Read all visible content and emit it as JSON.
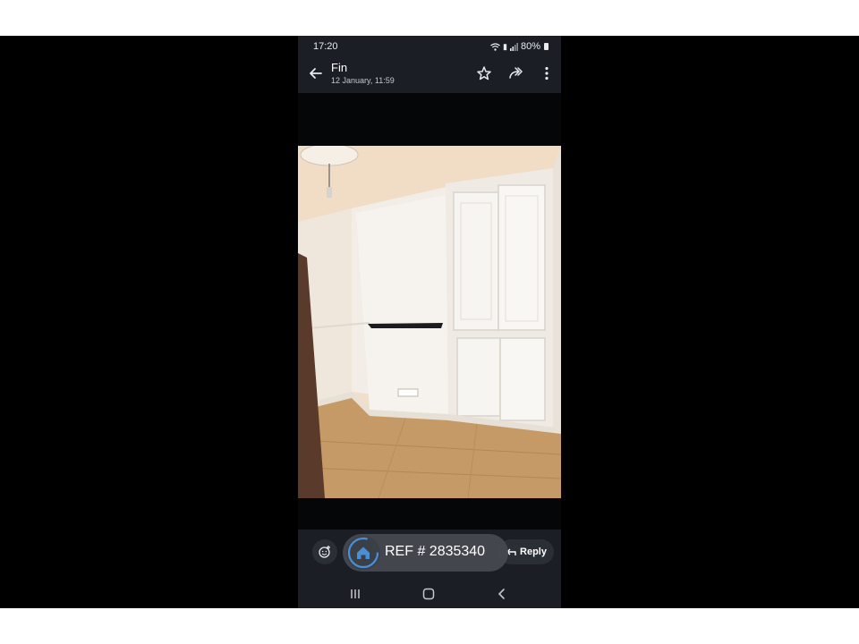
{
  "status_bar": {
    "time": "17:20",
    "battery": "80%",
    "icons": [
      "wifi-icon",
      "volte-icon",
      "signal-icon",
      "battery-icon"
    ]
  },
  "app_bar": {
    "sender": "Fin",
    "date": "12 January, 11:59",
    "actions": [
      "star-icon",
      "forward-icon",
      "more-vert-icon"
    ]
  },
  "photo": {
    "subject": "empty room with cream walls, built-in cupboards, fireplace shelf and laminate wood floor"
  },
  "bottom_bar": {
    "reply_label": "Reply",
    "emoji_icon": "add-reaction-icon"
  },
  "nav_bar": {
    "buttons": [
      "recents-icon",
      "home-nav-icon",
      "back-nav-icon"
    ]
  },
  "ref_badge": {
    "text": "REF # 2835340",
    "icon": "home-icon"
  },
  "colors": {
    "chrome": "#1b1f25",
    "background": "#000000",
    "accent": "#4a8fd6"
  }
}
